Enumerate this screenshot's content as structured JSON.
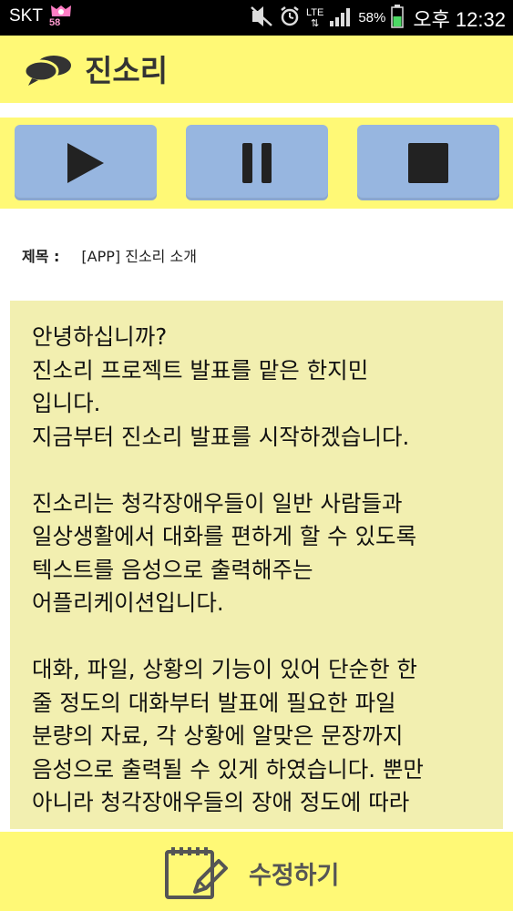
{
  "status_bar": {
    "carrier": "SKT",
    "notification_count": "58",
    "network": "LTE",
    "battery": "58%",
    "time": "오후 12:32"
  },
  "app": {
    "title": "진소리"
  },
  "controls": {
    "play_icon": "play-icon",
    "pause_icon": "pause-icon",
    "stop_icon": "stop-icon"
  },
  "subject": {
    "label": "제목 :",
    "value": "[APP] 진소리 소개"
  },
  "content": {
    "text": "안녕하십니까?\n진소리 프로젝트 발표를 맡은 한지민\n입니다.\n지금부터 진소리 발표를 시작하겠습니다.\n\n진소리는 청각장애우들이 일반 사람들과\n일상생활에서 대화를 편하게 할 수 있도록\n텍스트를 음성으로 출력해주는\n어플리케이션입니다.\n\n대화, 파일, 상황의 기능이 있어 단순한 한\n줄 정도의 대화부터 발표에 필요한 파일\n분량의 자료, 각 상황에 알맞은 문장까지\n음성으로 출력될 수 있게 하였습니다. 뿐만\n아니라 청각장애우들의 장애 정도에 따라"
  },
  "bottom": {
    "edit_label": "수정하기"
  },
  "colors": {
    "yellow": "#fff976",
    "button_blue": "#97b6e0",
    "panel": "#f2efb0"
  }
}
